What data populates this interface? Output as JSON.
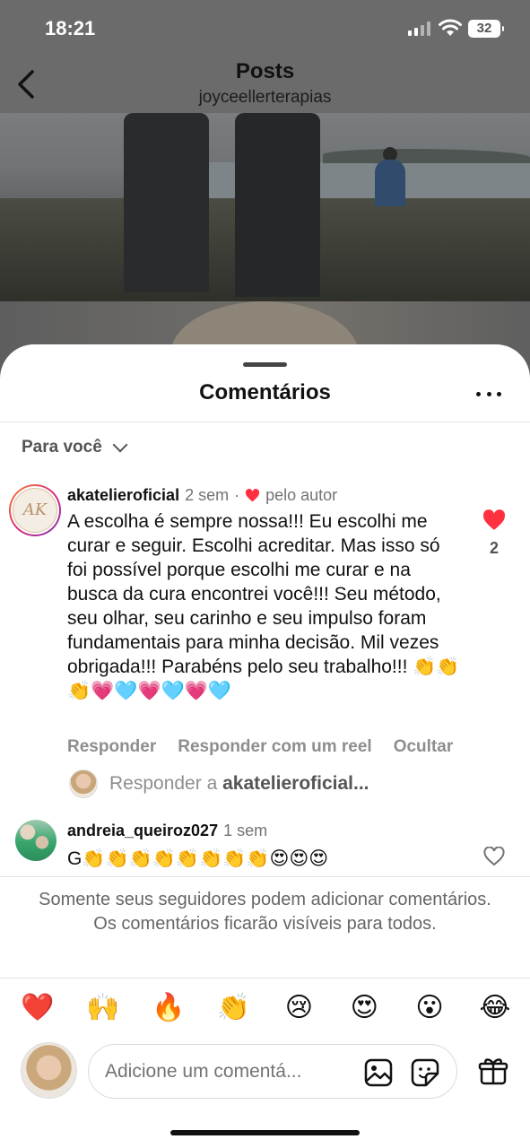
{
  "status_bar": {
    "time": "18:21",
    "battery": "32"
  },
  "nav": {
    "title": "Posts",
    "subtitle": "joyceellerterapias"
  },
  "sheet": {
    "title": "Comentários",
    "filter_label": "Para você",
    "comments": [
      {
        "username": "akatelieroficial",
        "time": "2 sem",
        "separator": "·",
        "author_badge": "pelo autor",
        "avatar_text": "AK",
        "text": "A escolha é sempre nossa!!! Eu escolhi me curar e seguir. Escolhi acreditar. Mas isso só foi possível porque escolhi me curar e na busca da cura encontrei você!!! Seu método, seu olhar, seu carinho e seu impulso foram fundamentais para minha decisão. Mil vezes obrigada!!! Parabéns pelo seu trabalho!!! 👏👏👏💗🩵💗🩵💗🩵",
        "likes": "2",
        "liked": true,
        "actions": {
          "reply": "Responder",
          "reply_reel": "Responder com um reel",
          "hide": "Ocultar"
        },
        "reply_prompt": {
          "prefix": "Responder a ",
          "target": "akatelieroficial..."
        }
      },
      {
        "username": "andreia_queiroz027",
        "time": "1 sem",
        "text": "G👏👏👏👏👏👏👏👏😍😍😍",
        "liked": false
      }
    ],
    "notice": "Somente seus seguidores podem adicionar comentários. Os comentários ficarão visíveis para todos.",
    "quick_emojis": [
      "❤️",
      "🙌",
      "🔥",
      "👏",
      "😢",
      "😍",
      "😮",
      "😂"
    ],
    "composer": {
      "placeholder": "Adicione um comentá..."
    }
  },
  "colors": {
    "like_red": "#ff3040",
    "muted_text": "#737373",
    "action_gray": "#8e8e8e"
  }
}
